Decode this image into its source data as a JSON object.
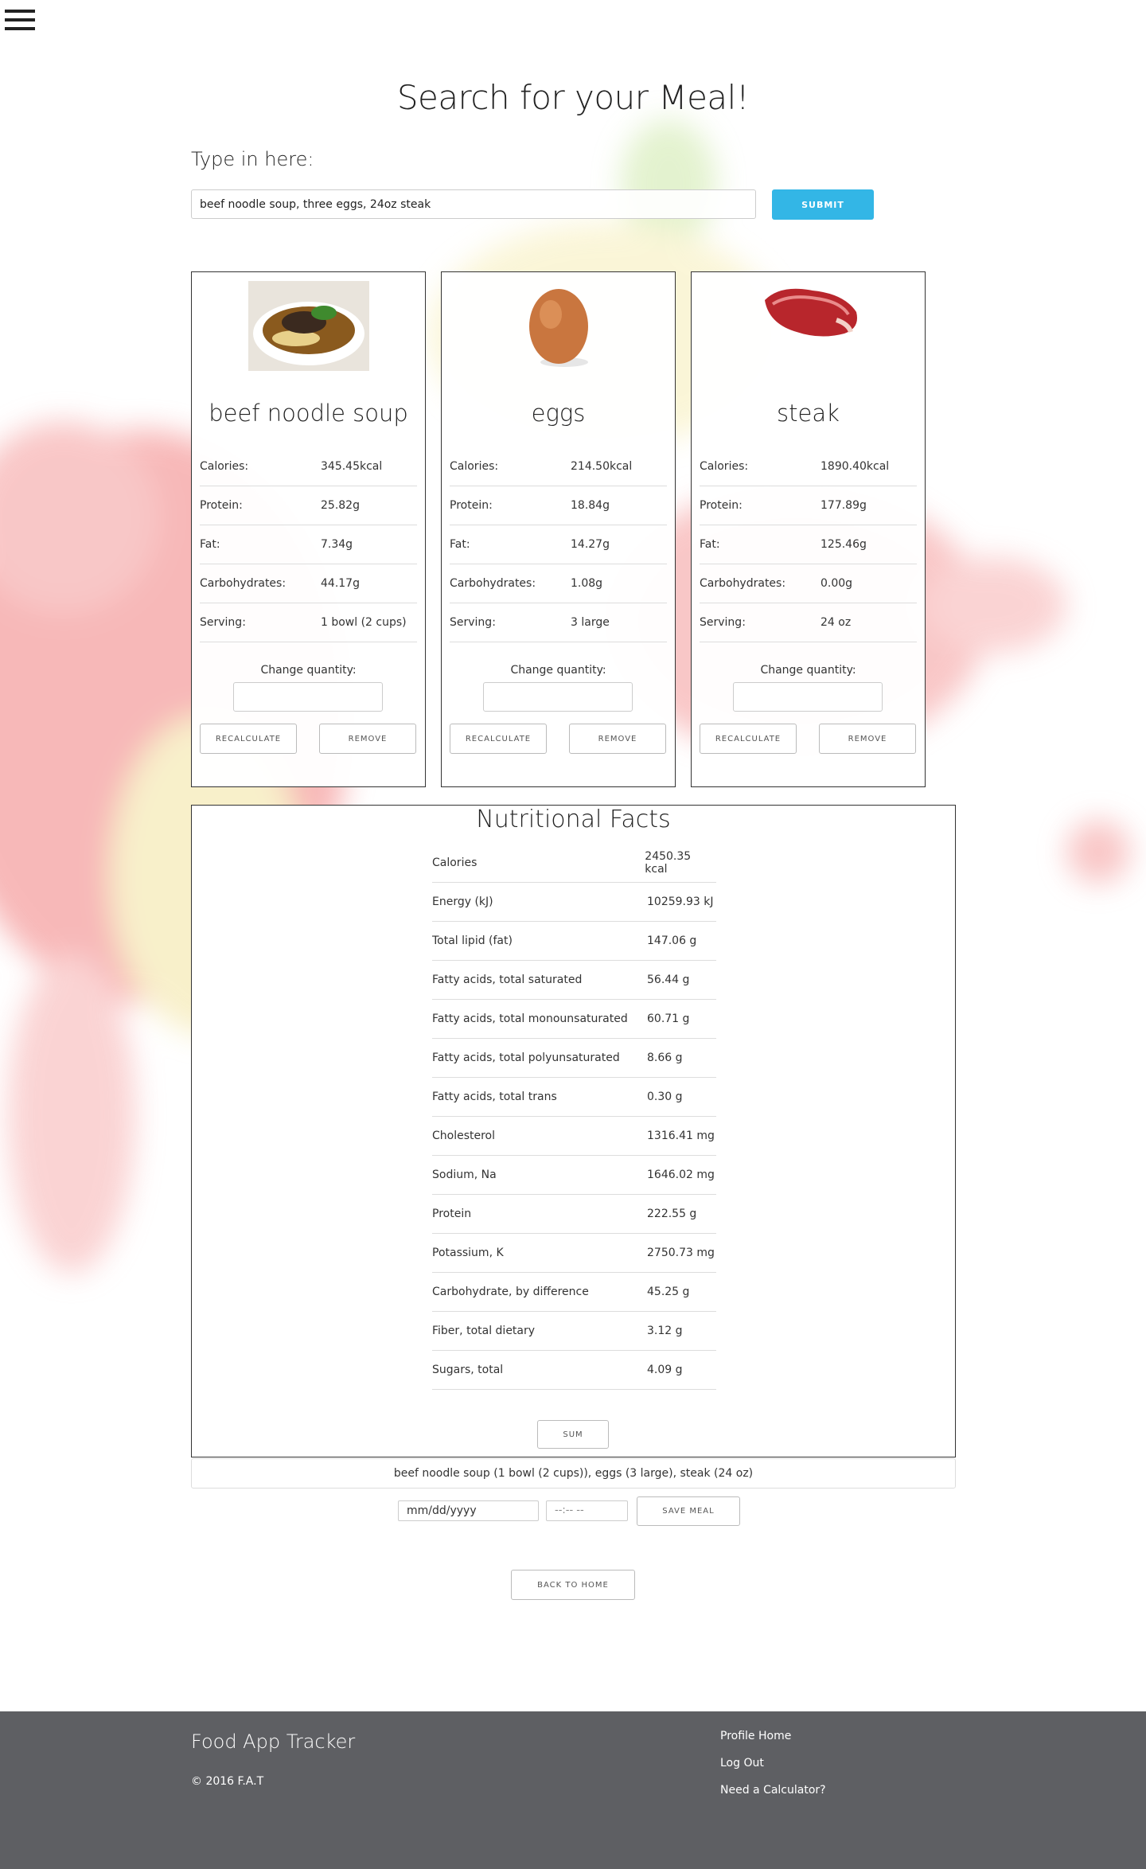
{
  "page": {
    "title": "Search for your Meal!",
    "type_label": "Type in here:"
  },
  "search": {
    "value": "beef noodle soup, three eggs, 24oz steak",
    "submit_label": "SUBMIT"
  },
  "cards": [
    {
      "name": "beef noodle soup",
      "image_icon": "beef-noodle-soup-image",
      "rows": [
        {
          "label": "Calories:",
          "value": "345.45kcal"
        },
        {
          "label": "Protein:",
          "value": "25.82g"
        },
        {
          "label": "Fat:",
          "value": "7.34g"
        },
        {
          "label": "Carbohydrates:",
          "value": "44.17g"
        },
        {
          "label": "Serving:",
          "value": "1 bowl (2 cups)"
        }
      ],
      "change_quantity_label": "Change quantity:",
      "recalculate_label": "RECALCULATE",
      "remove_label": "REMOVE"
    },
    {
      "name": "eggs",
      "image_icon": "egg-image",
      "rows": [
        {
          "label": "Calories:",
          "value": "214.50kcal"
        },
        {
          "label": "Protein:",
          "value": "18.84g"
        },
        {
          "label": "Fat:",
          "value": "14.27g"
        },
        {
          "label": "Carbohydrates:",
          "value": "1.08g"
        },
        {
          "label": "Serving:",
          "value": "3 large"
        }
      ],
      "change_quantity_label": "Change quantity:",
      "recalculate_label": "RECALCULATE",
      "remove_label": "REMOVE"
    },
    {
      "name": "steak",
      "image_icon": "steak-image",
      "rows": [
        {
          "label": "Calories:",
          "value": "1890.40kcal"
        },
        {
          "label": "Protein:",
          "value": "177.89g"
        },
        {
          "label": "Fat:",
          "value": "125.46g"
        },
        {
          "label": "Carbohydrates:",
          "value": "0.00g"
        },
        {
          "label": "Serving:",
          "value": "24 oz"
        }
      ],
      "change_quantity_label": "Change quantity:",
      "recalculate_label": "RECALCULATE",
      "remove_label": "REMOVE"
    }
  ],
  "facts": {
    "title": "Nutritional Facts",
    "rows": [
      {
        "label": "Calories",
        "value": "2450.35 kcal"
      },
      {
        "label": "Energy (kJ)",
        "value": "10259.93 kJ"
      },
      {
        "label": "Total lipid (fat)",
        "value": "147.06 g"
      },
      {
        "label": "Fatty acids, total saturated",
        "value": "56.44 g"
      },
      {
        "label": "Fatty acids, total monounsaturated",
        "value": "60.71 g"
      },
      {
        "label": "Fatty acids, total polyunsaturated",
        "value": "8.66 g"
      },
      {
        "label": "Fatty acids, total trans",
        "value": "0.30 g"
      },
      {
        "label": "Cholesterol",
        "value": "1316.41 mg"
      },
      {
        "label": "Sodium, Na",
        "value": "1646.02 mg"
      },
      {
        "label": "Protein",
        "value": "222.55 g"
      },
      {
        "label": "Potassium, K",
        "value": "2750.73 mg"
      },
      {
        "label": "Carbohydrate, by difference",
        "value": "45.25 g"
      },
      {
        "label": "Fiber, total dietary",
        "value": "3.12 g"
      },
      {
        "label": "Sugars, total",
        "value": "4.09 g"
      }
    ],
    "sum_label": "SUM"
  },
  "meal": {
    "summary": "beef noodle soup (1 bowl (2 cups)), eggs (3 large), steak (24  oz)",
    "date_placeholder": "mm/dd/yyyy",
    "time_placeholder": "--:-- --",
    "save_label": "SAVE MEAL"
  },
  "back_label": "BACK TO HOME",
  "footer": {
    "brand": "Food App Tracker",
    "copyright": "© 2016 F.A.T",
    "links": [
      "Profile Home",
      "Log Out",
      "Need a Calculator?"
    ]
  },
  "colors": {
    "accent": "#33b6e6",
    "footer_bg": "#5e5f63",
    "splash_red": "#f28a8a",
    "splash_yellow": "#f5e6a0"
  }
}
